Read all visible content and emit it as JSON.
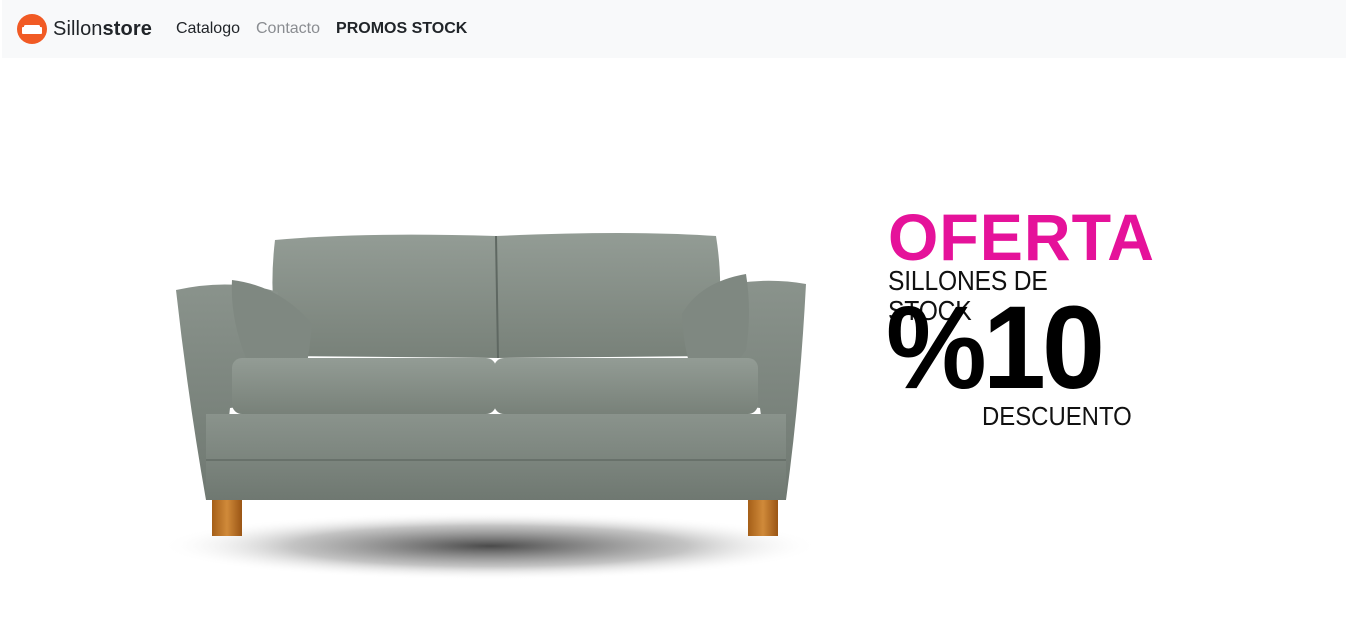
{
  "navbar": {
    "brand": {
      "light": "Sillon",
      "bold": "store",
      "logo_icon": "sofa-icon",
      "logo_color": "#f15a24"
    },
    "links": [
      {
        "label": "Catalogo"
      },
      {
        "label": "Contacto"
      },
      {
        "label": "PROMOS STOCK"
      }
    ]
  },
  "hero": {
    "image": "grey-sofa",
    "promo": {
      "title": "OFERTA",
      "subtitle": "SILLONES DE STOCK",
      "discount": "%10",
      "discount_label": "DESCUENTO",
      "title_color": "#e5129a"
    }
  }
}
